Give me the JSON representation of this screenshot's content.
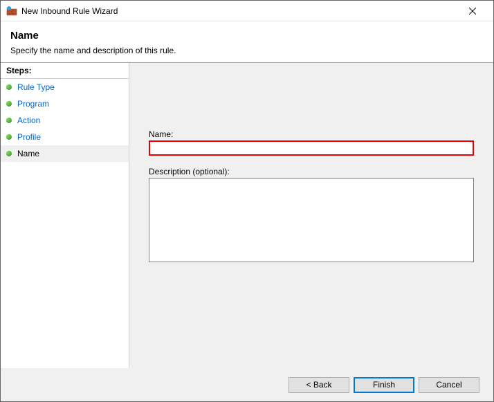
{
  "window": {
    "title": "New Inbound Rule Wizard"
  },
  "header": {
    "heading": "Name",
    "subtitle": "Specify the name and description of this rule."
  },
  "sidebar": {
    "steps_label": "Steps:",
    "items": [
      {
        "label": "Rule Type"
      },
      {
        "label": "Program"
      },
      {
        "label": "Action"
      },
      {
        "label": "Profile"
      },
      {
        "label": "Name"
      }
    ]
  },
  "form": {
    "name_label": "Name:",
    "name_value": "",
    "description_label": "Description (optional):",
    "description_value": ""
  },
  "footer": {
    "back": "< Back",
    "finish": "Finish",
    "cancel": "Cancel"
  }
}
